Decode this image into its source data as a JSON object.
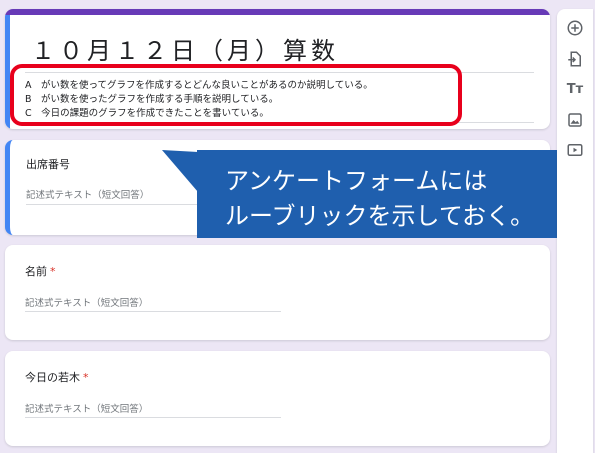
{
  "form": {
    "title": "１０月１２日（月）算数",
    "rubric": [
      "A　がい数を使ってグラフを作成するとどんな良いことがあるのか説明している。",
      "B　がい数を使ったグラフを作成する手順を説明している。",
      "C　今日の課題のグラフを作成できたことを書いている。"
    ]
  },
  "questions": [
    {
      "label": "出席番号",
      "required": "",
      "placeholder": "記述式テキスト（短文回答）"
    },
    {
      "label": "名前",
      "required": "*",
      "placeholder": "記述式テキスト（短文回答）"
    },
    {
      "label": "今日の若木",
      "required": "*",
      "placeholder": "記述式テキスト（短文回答）"
    }
  ],
  "callout": {
    "line1": "アンケートフォームには",
    "line2": "ルーブリックを示しておく。"
  },
  "toolbar": {
    "title_icon_text": "Tт"
  },
  "colors": {
    "accent_purple": "#673ab7",
    "focus_blue": "#4285f4",
    "highlight_red": "#e8001c",
    "callout_blue": "#1f5fae",
    "required_red": "#d93025"
  }
}
